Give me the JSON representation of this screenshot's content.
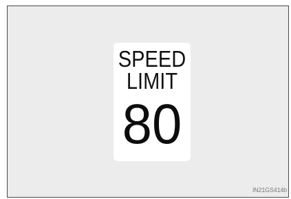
{
  "sign": {
    "line1": "SPEED",
    "line2": "LIMIT",
    "number": "80"
  },
  "figure_code": "IN21GS414b"
}
